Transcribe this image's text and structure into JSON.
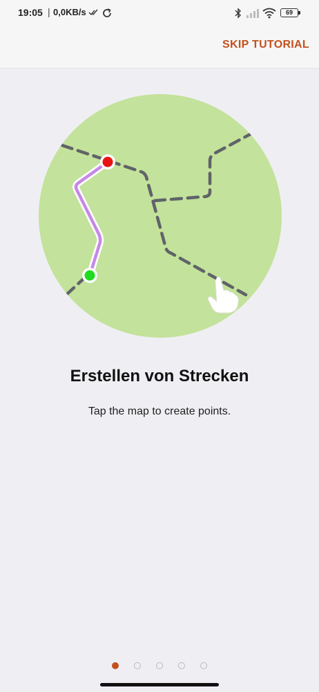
{
  "status_bar": {
    "time": "19:05",
    "separator": "|",
    "network_speed": "0,0KB/s",
    "battery": "69"
  },
  "header": {
    "skip_label": "SKIP TUTORIAL"
  },
  "tutorial": {
    "title": "Erstellen von Strecken",
    "description": "Tap the map to create points."
  },
  "pager": {
    "total_pages": 5,
    "current_page": 1
  },
  "colors": {
    "accent": "#c4501e",
    "map_green": "#c3e29b",
    "route_purple": "#c688e8",
    "start_point": "#1fdc1f",
    "end_point": "#e81414",
    "background": "#efeff3"
  }
}
